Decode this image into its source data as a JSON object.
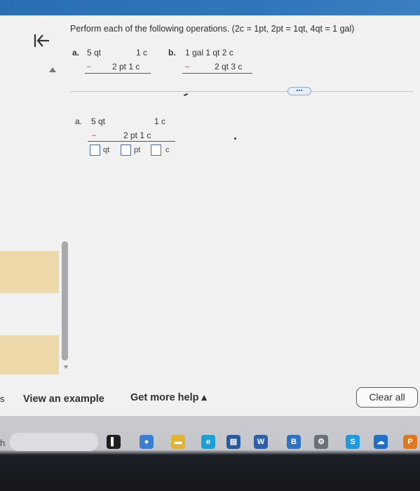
{
  "header": {
    "instructions": "Perform each of the following operations. (2c = 1pt, 2pt = 1qt, 4qt = 1 gal)"
  },
  "problem_a": {
    "label": "a.",
    "top_left": "5 qt",
    "top_right": "1 c",
    "minus": "–",
    "bottom": "2 pt  1 c"
  },
  "problem_b": {
    "label": "b.",
    "top": "1 gal  1 qt  2 c",
    "minus": "–",
    "bottom": "2 qt  3 c"
  },
  "more_button": "•••",
  "work_area": {
    "label": "a.",
    "top_left": "5 qt",
    "top_right": "1 c",
    "minus": "–",
    "bottom": "2 pt   1 c",
    "units": [
      "qt",
      "pt",
      "c"
    ]
  },
  "footer": {
    "view_example": "View an example",
    "get_help": "Get more help ▴",
    "clear_all": "Clear all"
  },
  "edge_chars": [
    "s",
    "h"
  ],
  "taskbar": {
    "icons": [
      {
        "name": "file-explorer-icon",
        "color": "#1f1f1f",
        "glyph": "▌"
      },
      {
        "name": "chat-icon",
        "color": "#3b7fd4",
        "glyph": "●"
      },
      {
        "name": "folder-icon",
        "color": "#e3b22f",
        "glyph": "▬"
      },
      {
        "name": "edge-browser-icon",
        "color": "#1a9fd6",
        "glyph": "e"
      },
      {
        "name": "store-icon",
        "color": "#2a5a9e",
        "glyph": "▤"
      },
      {
        "name": "word-icon",
        "color": "#2b5faa",
        "glyph": "W"
      },
      {
        "name": "bing-icon",
        "color": "#2f72c4",
        "glyph": "B"
      },
      {
        "name": "settings-icon",
        "color": "#6b6f78",
        "glyph": "⚙"
      },
      {
        "name": "skype-icon",
        "color": "#1e9be0",
        "glyph": "S"
      },
      {
        "name": "onedrive-icon",
        "color": "#1d6fc7",
        "glyph": "☁"
      },
      {
        "name": "profile-icon",
        "color": "#e0781f",
        "glyph": "P"
      }
    ]
  }
}
